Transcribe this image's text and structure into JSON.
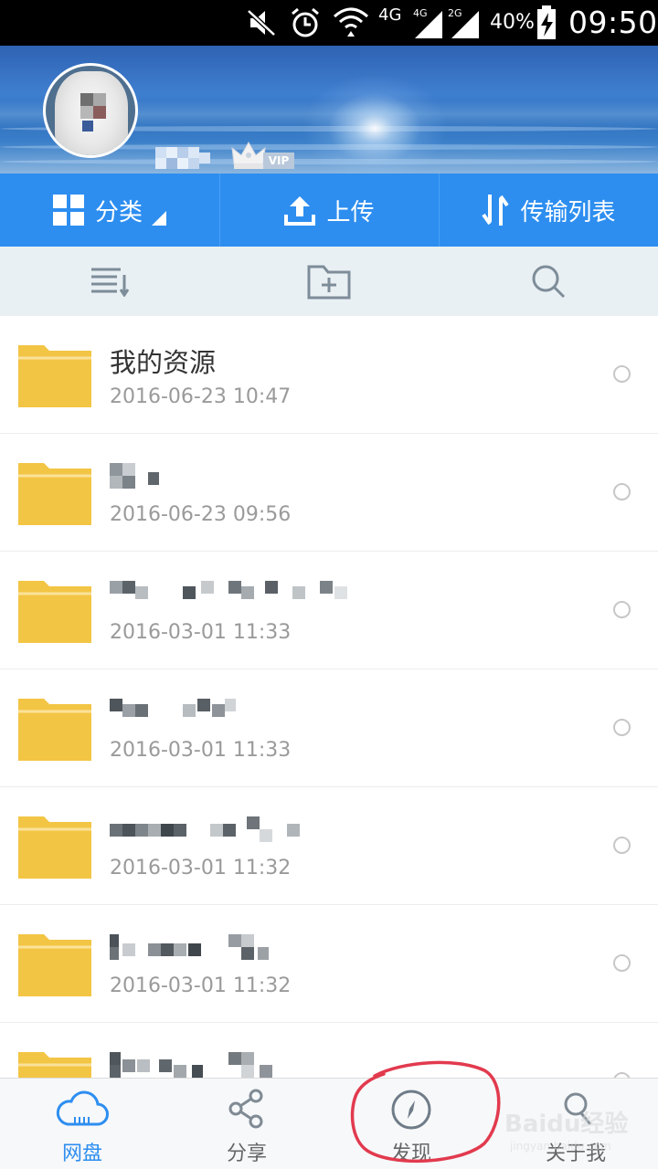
{
  "status_bar": {
    "network_label_1": "4G",
    "network_label_2": "4G",
    "network_label_3": "2G",
    "battery": "40%",
    "time": "09:50"
  },
  "profile": {
    "vip_label": "VIP"
  },
  "action_bar": {
    "category_label": "分类",
    "upload_label": "上传",
    "transfer_label": "传输列表"
  },
  "files": [
    {
      "name": "我的资源",
      "date": "2016-06-23  10:47",
      "name_obscured": false
    },
    {
      "name": "",
      "date": "2016-06-23  09:56",
      "name_obscured": true
    },
    {
      "name": "",
      "date": "2016-03-01  11:33",
      "name_obscured": true
    },
    {
      "name": "",
      "date": "2016-03-01  11:33",
      "name_obscured": true
    },
    {
      "name": "",
      "date": "2016-03-01  11:32",
      "name_obscured": true
    },
    {
      "name": "",
      "date": "2016-03-01  11:32",
      "name_obscured": true
    },
    {
      "name": "",
      "date": "",
      "name_obscured": true
    }
  ],
  "bottom_nav": {
    "items": [
      {
        "label": "网盘",
        "icon": "cloud-icon",
        "active": true
      },
      {
        "label": "分享",
        "icon": "share-icon",
        "active": false
      },
      {
        "label": "发现",
        "icon": "compass-icon",
        "active": false
      },
      {
        "label": "关于我",
        "icon": "person-icon",
        "active": false
      }
    ]
  },
  "watermark": {
    "main": "Baidu经验",
    "sub": "jingyan.baidu.com"
  },
  "colors": {
    "accent": "#2d8ef0",
    "folder": "#f3c545",
    "annotation": "#e23a4e"
  }
}
